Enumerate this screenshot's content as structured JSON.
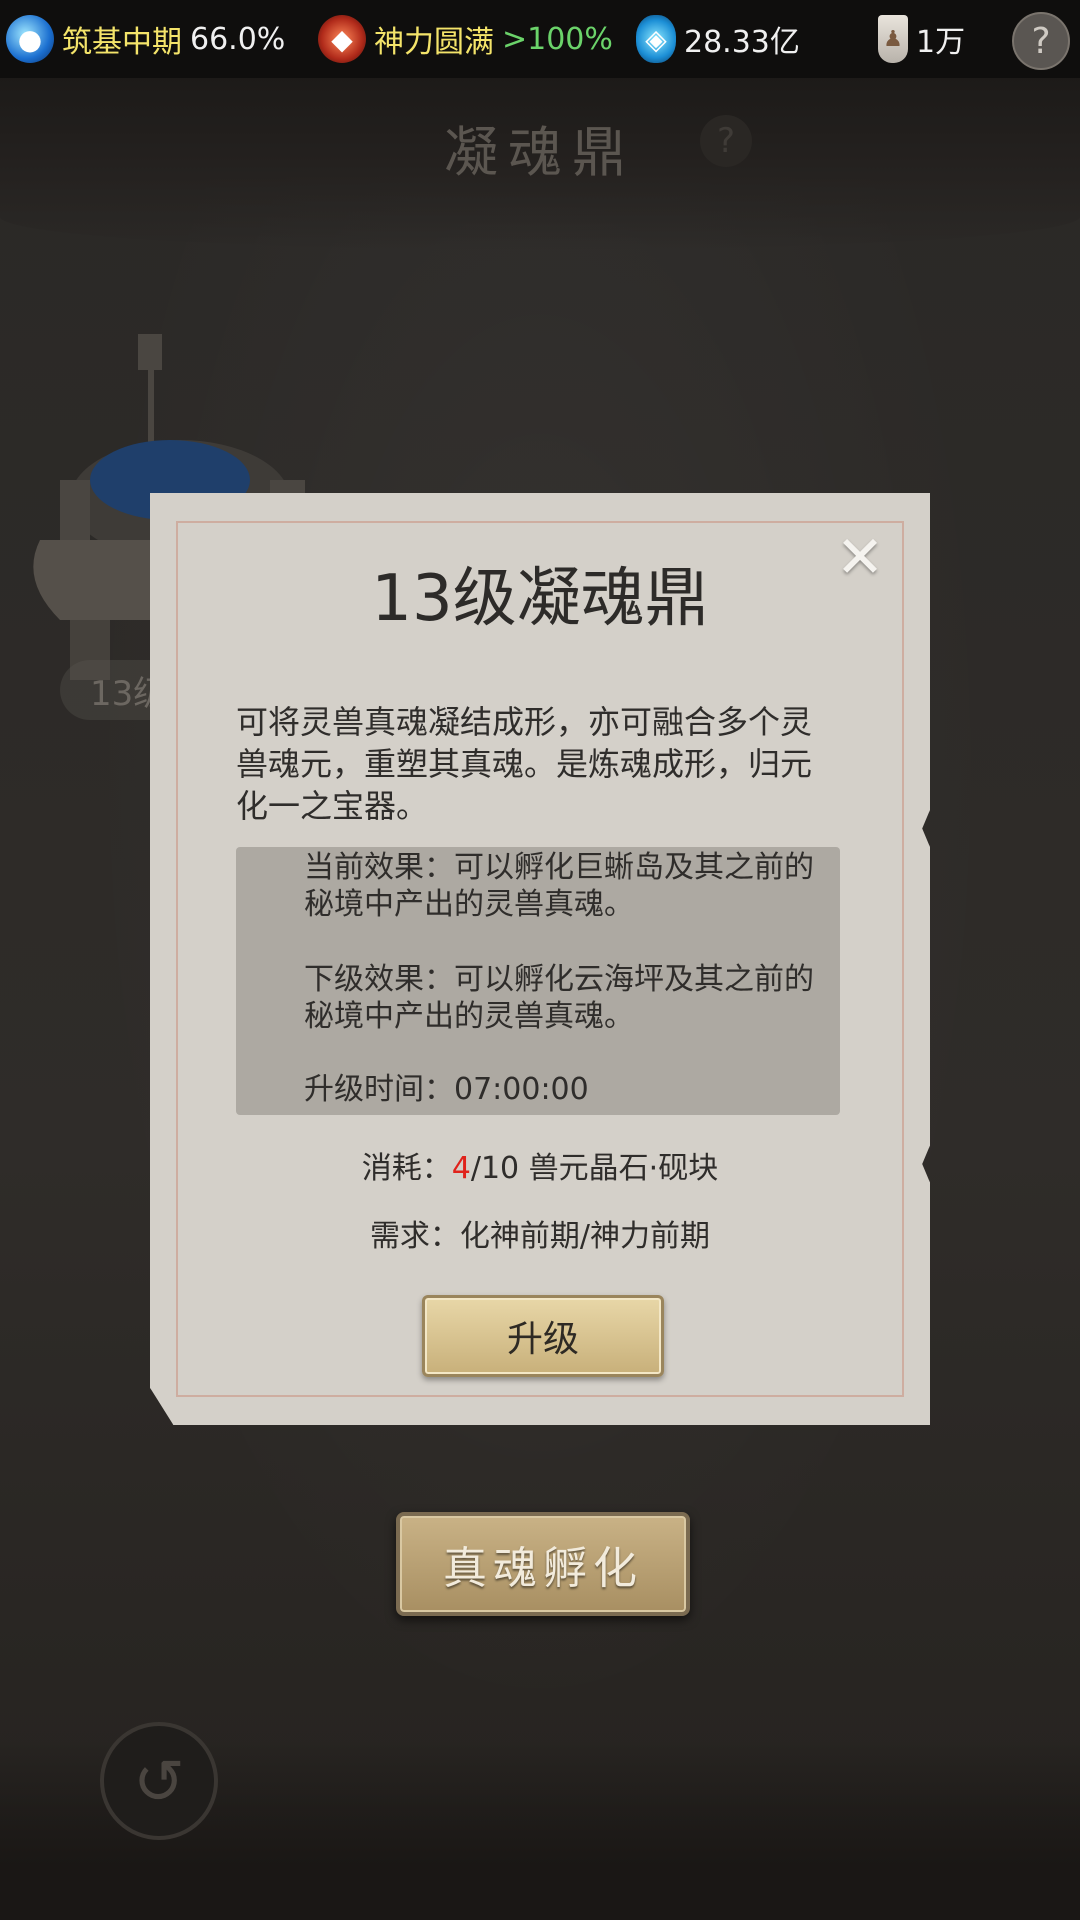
{
  "topbar": {
    "cultivation": {
      "label": "筑基中期",
      "value": "66.0%"
    },
    "divine": {
      "label": "神力圆满",
      "value": ">100%"
    },
    "spirit_stone": {
      "value": "28.33亿"
    },
    "scroll": {
      "value": "1万"
    },
    "help": "?"
  },
  "page": {
    "title": "凝魂鼎",
    "title_help": "?",
    "cauldron_level": "13级"
  },
  "modal": {
    "title": "13级凝魂鼎",
    "close": "✕",
    "description": "可将灵兽真魂凝结成形，亦可融合多个灵兽魂元，重塑其真魂。是炼魂成形，归元化一之宝器。",
    "current_effect": "当前效果：可以孵化巨蜥岛及其之前的秘境中产出的灵兽真魂。",
    "next_effect": "下级效果：可以孵化云海坪及其之前的秘境中产出的灵兽真魂。",
    "upgrade_time": "升级时间：07:00:00",
    "cost_label": "消耗：",
    "cost_have": "4",
    "cost_rest": "/10 兽元晶石·砚块",
    "requirement": "需求：化神前期/神力前期",
    "upgrade_button": "升级"
  },
  "hatch_button": "真魂孵化",
  "back_button": "↺",
  "colors": {
    "accent_green": "#6bd36a",
    "accent_red": "#e0221b",
    "label_yellow": "#f4e46a"
  }
}
